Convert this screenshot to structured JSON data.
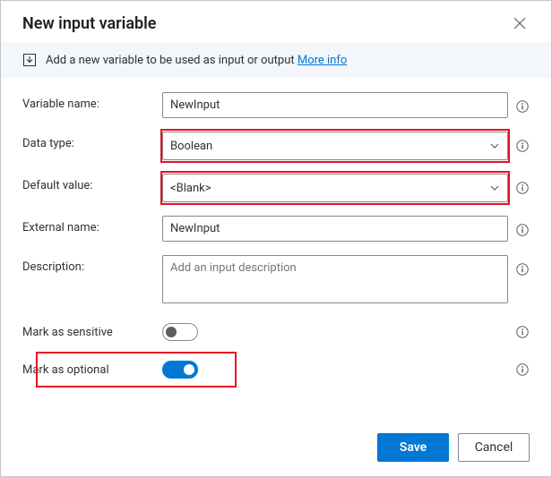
{
  "dialog": {
    "title": "New input variable",
    "close": "×"
  },
  "banner": {
    "text": "Add a new variable to be used as input or output ",
    "moreInfo": "More info"
  },
  "labels": {
    "variableName": "Variable name:",
    "dataType": "Data type:",
    "defaultValue": "Default value:",
    "externalName": "External name:",
    "description": "Description:",
    "sensitive": "Mark as sensitive",
    "optional": "Mark as optional"
  },
  "fields": {
    "variableName": "NewInput",
    "dataType": "Boolean",
    "defaultValue": "<Blank>",
    "externalName": "NewInput",
    "descriptionPlaceholder": "Add an input description",
    "sensitive": false,
    "optional": true
  },
  "buttons": {
    "save": "Save",
    "cancel": "Cancel"
  }
}
